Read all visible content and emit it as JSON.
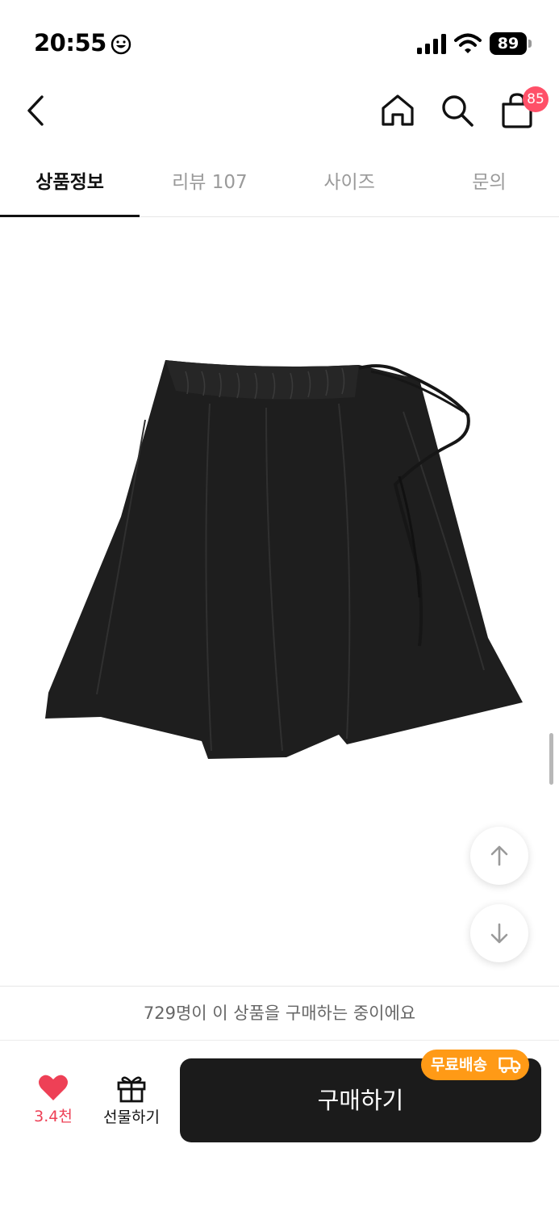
{
  "status_bar": {
    "time": "20:55",
    "battery": "89"
  },
  "nav": {
    "cart_count": "85"
  },
  "tabs": [
    {
      "label": "상품정보",
      "active": true
    },
    {
      "label": "리뷰 107",
      "active": false
    },
    {
      "label": "사이즈",
      "active": false
    },
    {
      "label": "문의",
      "active": false
    }
  ],
  "product": {
    "image_subject": "black wide shorts"
  },
  "notice": {
    "text": "729명이 이 상품을 구매하는 중이에요"
  },
  "bottom_bar": {
    "like_count": "3.4천",
    "gift_label": "선물하기",
    "buy_label": "구매하기",
    "free_shipping": "무료배송"
  },
  "colors": {
    "accent_red": "#ff5068",
    "like_red": "#ee4056",
    "shipping_orange": "#ff9a16",
    "buy_button": "#1b1b1b"
  }
}
